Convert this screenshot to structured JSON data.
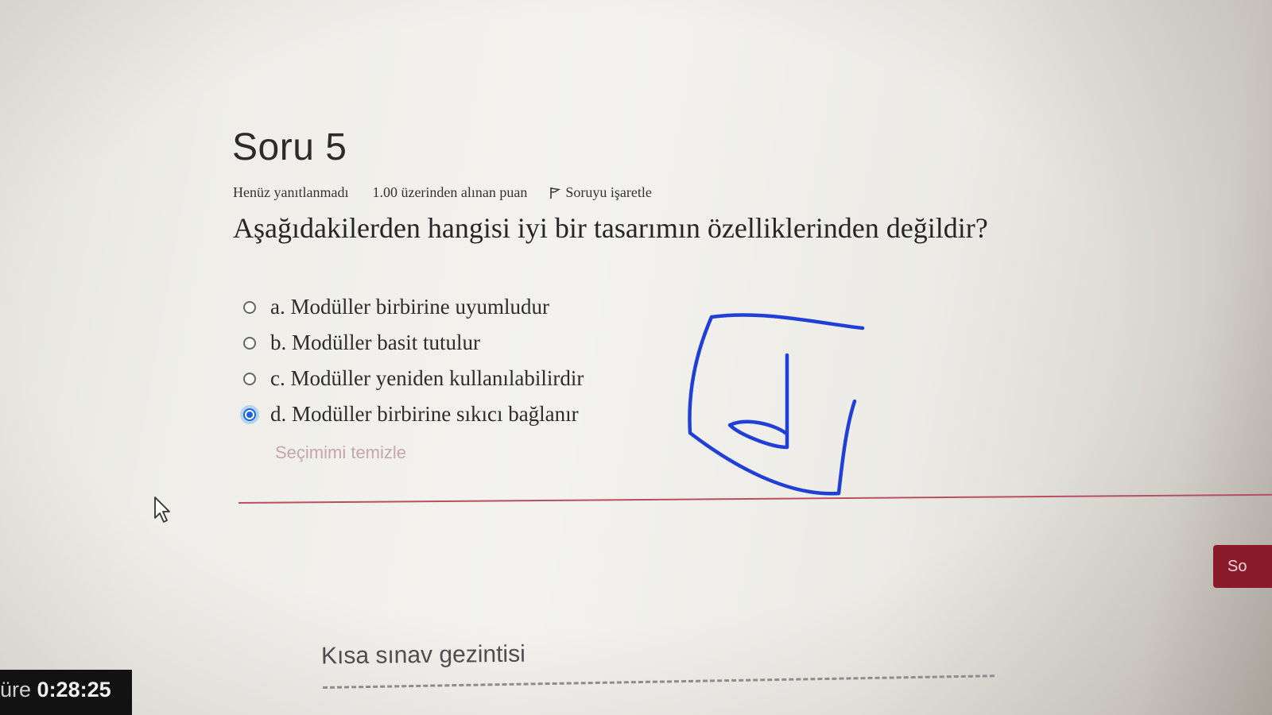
{
  "question": {
    "title": "Soru 5",
    "state": "Henüz yanıtlanmadı",
    "grade": "1.00 üzerinden alınan puan",
    "flag_label": "Soruyu işaretle",
    "text": "Aşağıdakilerden hangisi iyi bir tasarımın özelliklerinden değildir?",
    "answers": [
      {
        "label": "a. Modüller birbirine uyumludur",
        "selected": false
      },
      {
        "label": "b. Modüller basit tutulur",
        "selected": false
      },
      {
        "label": "c. Modüller yeniden kullanılabilirdir",
        "selected": false
      },
      {
        "label": "d. Modüller birbirine sıkıcı bağlanır",
        "selected": true
      }
    ],
    "clear_label": "Seçimimi temizle"
  },
  "next_button_label": "So",
  "quiz_navigation_title": "Kısa sınav gezintisi",
  "timer": {
    "label": "üre",
    "value": "0:28:25"
  },
  "colors": {
    "accent": "#8b1a2b",
    "radio_selected": "#1a66d9",
    "scribble": "#1f3fd6",
    "divider": "#b8505f"
  }
}
